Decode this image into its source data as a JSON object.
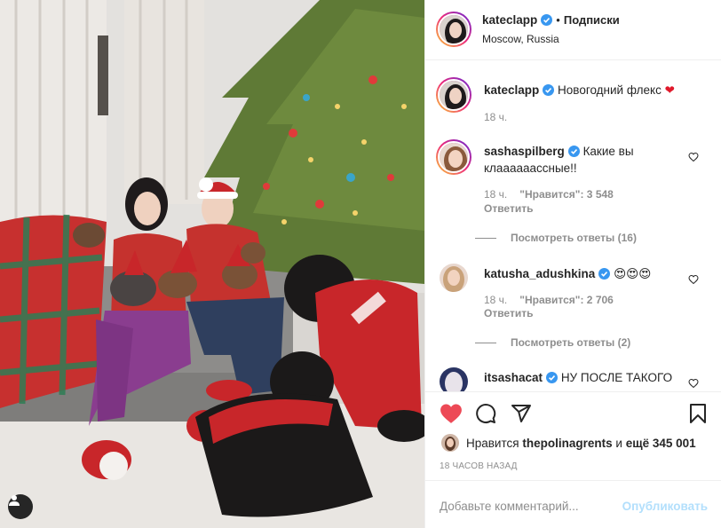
{
  "post": {
    "author": "kateclapp",
    "follow_separator": "•",
    "follow_label": "Подписки",
    "location": "Moscow, Russia",
    "caption": "Новогодний флекс",
    "caption_emoji": "❤",
    "caption_time": "18 ч.",
    "verified_icon": "verified-badge-icon",
    "accent_color": "#3897f0"
  },
  "comments": [
    {
      "username": "sashaspilberg",
      "text": "Какие вы клаааааассные!!",
      "time": "18 ч.",
      "likes_label": "\"Нравится\": 3 548",
      "reply_label": "Ответить",
      "view_replies": "Посмотреть ответы (16)"
    },
    {
      "username": "katusha_adushkina",
      "text": "😍😍😍",
      "time": "18 ч.",
      "likes_label": "\"Нравится\": 2 706",
      "reply_label": "Ответить",
      "view_replies": "Посмотреть ответы (2)"
    },
    {
      "username": "itsashacat",
      "text": "НУ ПОСЛЕ ТАКОГО"
    }
  ],
  "actions": {
    "like_color": "#ed4956",
    "likes_prefix": "Нравится",
    "likes_user": "thepolinagrents",
    "likes_suffix_word": "и",
    "likes_others": "ещё 345 001",
    "timestamp": "18 ЧАСОВ НАЗАД"
  },
  "add_comment": {
    "placeholder": "Добавьте комментарий...",
    "post_label": "Опубликовать"
  }
}
